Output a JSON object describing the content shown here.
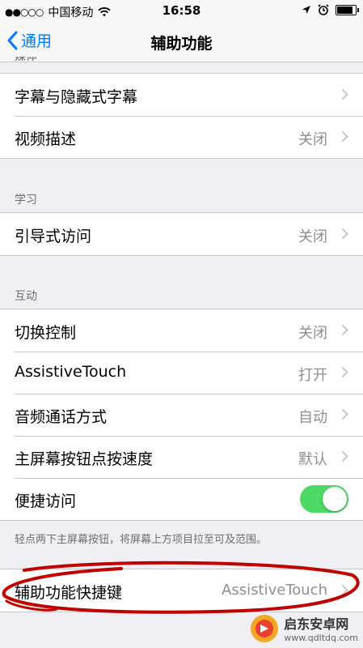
{
  "status_bar": {
    "signal_dots": "●●○○○",
    "carrier": "中国移动",
    "time": "16:58"
  },
  "navbar": {
    "back_label": "通用",
    "title": "辅助功能"
  },
  "top_section": {
    "cut_label": "媒体",
    "rows": [
      {
        "label": "字幕与隐藏式字幕",
        "value": ""
      },
      {
        "label": "视频描述",
        "value": "关闭"
      }
    ]
  },
  "learning": {
    "header": "学习",
    "rows": [
      {
        "label": "引导式访问",
        "value": "关闭"
      }
    ]
  },
  "interaction": {
    "header": "互动",
    "rows": [
      {
        "label": "切换控制",
        "value": "关闭"
      },
      {
        "label": "AssistiveTouch",
        "value": "打开"
      },
      {
        "label": "音频通话方式",
        "value": "自动"
      },
      {
        "label": "主屏幕按钮点按速度",
        "value": "默认"
      },
      {
        "label": "便捷访问",
        "toggle_on": true
      }
    ],
    "footnote": "轻点两下主屏幕按钮，将屏幕上方项目拉至可及范围。"
  },
  "shortcut": {
    "rows": [
      {
        "label": "辅助功能快捷键",
        "value": "AssistiveTouch"
      }
    ]
  },
  "watermark": {
    "title": "启东安卓网",
    "url": "www.qdltdq.com"
  },
  "colors": {
    "accent": "#007aff",
    "toggle_on": "#4cd964",
    "annotation": "#c00000"
  }
}
